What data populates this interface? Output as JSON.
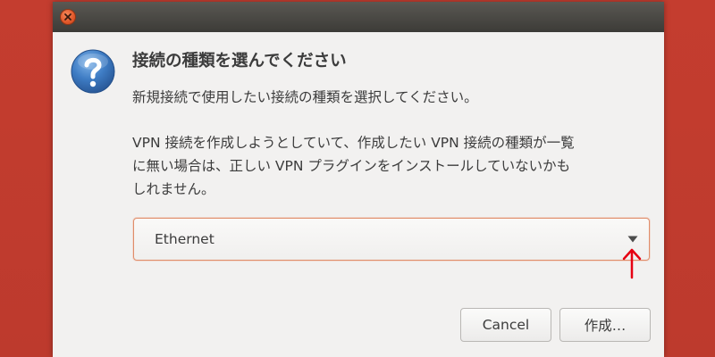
{
  "dialog": {
    "heading": "接続の種類を選んでください",
    "subtext": "新規接続で使用したい接続の種類を選択してください。",
    "body_lines": [
      "VPN 接続を作成しようとしていて、作成したい VPN 接続の種類が一覧",
      "に無い場合は、正しい VPN プラグインをインストールしていないかも",
      "しれません。"
    ],
    "combo": {
      "selected": "Ethernet"
    },
    "buttons": {
      "cancel": "Cancel",
      "create": "作成…"
    }
  },
  "icons": {
    "close": "close-icon",
    "question": "question-icon",
    "dropdown": "dropdown-arrow-icon",
    "annotation": "red-up-arrow-icon"
  },
  "colors": {
    "desktop_background": "#c0392b",
    "titlebar": "#3c3b37",
    "close_button": "#e25a2c",
    "annotation_arrow": "#e60012",
    "focus_border": "#e08d6a"
  }
}
